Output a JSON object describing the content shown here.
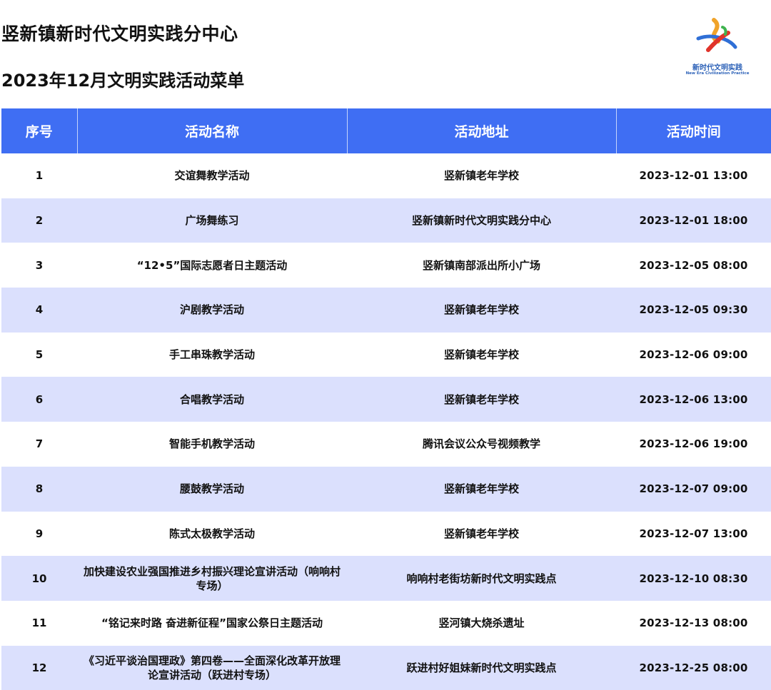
{
  "header": {
    "title": "竖新镇新时代文明实践分中心",
    "subtitle": "2023年12月文明实践活动菜单"
  },
  "logo": {
    "text_cn": "新时代文明实践",
    "text_en": "New Era Civilization Practice"
  },
  "table": {
    "columns": [
      "序号",
      "活动名称",
      "活动地址",
      "活动时间"
    ],
    "rows": [
      {
        "no": "1",
        "name": "交谊舞教学活动",
        "address": "竖新镇老年学校",
        "time": "2023-12-01 13:00"
      },
      {
        "no": "2",
        "name": "广场舞练习",
        "address": "竖新镇新时代文明实践分中心",
        "time": "2023-12-01 18:00"
      },
      {
        "no": "3",
        "name": "“12•5”国际志愿者日主题活动",
        "address": "竖新镇南部派出所小广场",
        "time": "2023-12-05 08:00"
      },
      {
        "no": "4",
        "name": "沪剧教学活动",
        "address": "竖新镇老年学校",
        "time": "2023-12-05 09:30"
      },
      {
        "no": "5",
        "name": "手工串珠教学活动",
        "address": "竖新镇老年学校",
        "time": "2023-12-06 09:00"
      },
      {
        "no": "6",
        "name": "合唱教学活动",
        "address": "竖新镇老年学校",
        "time": "2023-12-06 13:00"
      },
      {
        "no": "7",
        "name": "智能手机教学活动",
        "address": "腾讯会议公众号视频教学",
        "time": "2023-12-06 19:00"
      },
      {
        "no": "8",
        "name": "腰鼓教学活动",
        "address": "竖新镇老年学校",
        "time": "2023-12-07 09:00"
      },
      {
        "no": "9",
        "name": "陈式太极教学活动",
        "address": "竖新镇老年学校",
        "time": "2023-12-07 13:00"
      },
      {
        "no": "10",
        "name": "加快建设农业强国推进乡村振兴理论宣讲活动（响响村专场）",
        "address": "响响村老街坊新时代文明实践点",
        "time": "2023-12-10 08:30"
      },
      {
        "no": "11",
        "name": "“铭记来时路 奋进新征程”国家公祭日主题活动",
        "address": "竖河镇大烧杀遗址",
        "time": "2023-12-13 08:00"
      },
      {
        "no": "12",
        "name": "《习近平谈治国理政》第四卷——全面深化改革开放理论宣讲活动（跃进村专场）",
        "address": "跃进村好姐妹新时代文明实践点",
        "time": "2023-12-25 08:00"
      }
    ]
  }
}
